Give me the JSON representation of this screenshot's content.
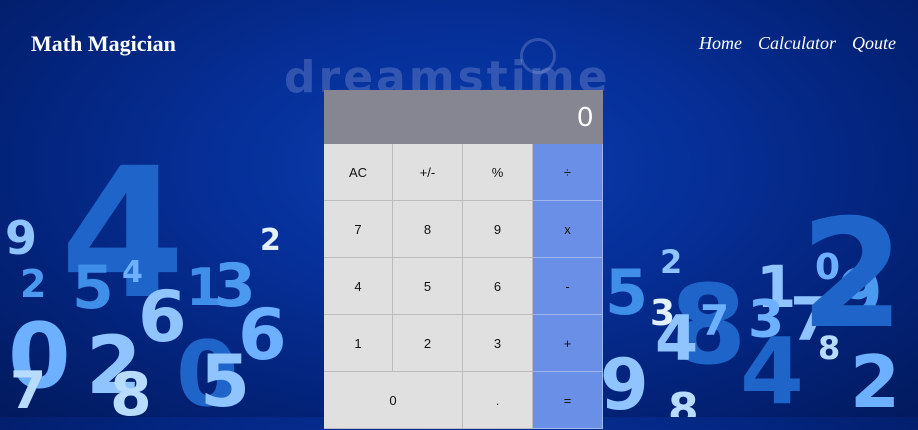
{
  "header": {
    "brand": "Math Magician",
    "nav": [
      {
        "label": "Home"
      },
      {
        "label": "Calculator"
      },
      {
        "label": "Qoute"
      }
    ]
  },
  "calculator": {
    "display": "0",
    "keys": [
      {
        "label": "AC",
        "type": "function"
      },
      {
        "label": "+/-",
        "type": "function"
      },
      {
        "label": "%",
        "type": "function"
      },
      {
        "label": "÷",
        "type": "operator"
      },
      {
        "label": "7",
        "type": "digit"
      },
      {
        "label": "8",
        "type": "digit"
      },
      {
        "label": "9",
        "type": "digit"
      },
      {
        "label": "x",
        "type": "operator"
      },
      {
        "label": "4",
        "type": "digit"
      },
      {
        "label": "5",
        "type": "digit"
      },
      {
        "label": "6",
        "type": "digit"
      },
      {
        "label": "-",
        "type": "operator"
      },
      {
        "label": "1",
        "type": "digit"
      },
      {
        "label": "2",
        "type": "digit"
      },
      {
        "label": "3",
        "type": "digit"
      },
      {
        "label": "+",
        "type": "operator"
      },
      {
        "label": "0",
        "type": "digit"
      },
      {
        "label": ".",
        "type": "digit"
      },
      {
        "label": "=",
        "type": "operator"
      }
    ]
  },
  "background": {
    "watermark": "dreamstime",
    "colors": {
      "base": "#03237a",
      "digits_light": "#8fc4ff",
      "digits_mid": "#3f8ee8",
      "operator_key": "#6a8fe6",
      "display": "#858692"
    }
  }
}
